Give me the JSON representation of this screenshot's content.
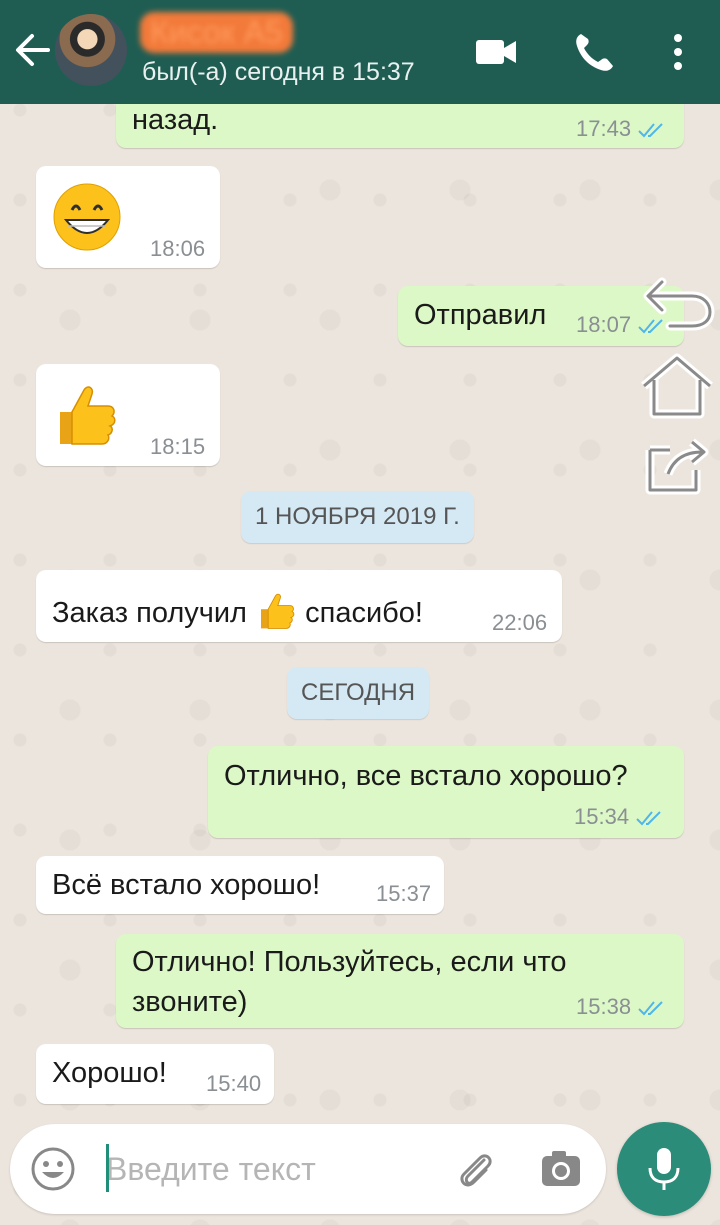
{
  "header": {
    "contact_name": "Кисок А5",
    "status": "был(-а) сегодня в 15:37"
  },
  "messages": [
    {
      "id": "m1",
      "dir": "out",
      "text": "назад.",
      "time": "17:43"
    },
    {
      "id": "m2",
      "dir": "in",
      "emoji": "grinning-face",
      "time": "18:06"
    },
    {
      "id": "m3",
      "dir": "out",
      "text": "Отправил",
      "time": "18:07"
    },
    {
      "id": "m4",
      "dir": "in",
      "emoji": "thumbs-up",
      "time": "18:15"
    },
    {
      "id": "m5",
      "dir": "in",
      "text_before": "Заказ получил",
      "emoji": "thumbs-up",
      "text_after": "спасибо!",
      "time": "22:06"
    },
    {
      "id": "m6",
      "dir": "out",
      "text": "Отлично, все встало хорошо?",
      "time": "15:34"
    },
    {
      "id": "m7",
      "dir": "in",
      "text": "Всё встало хорошо!",
      "time": "15:37"
    },
    {
      "id": "m8",
      "dir": "out",
      "text_line1": "Отлично! Пользуйтесь, если что",
      "text_line2": "звоните)",
      "time": "15:38"
    },
    {
      "id": "m9",
      "dir": "in",
      "text": "Хорошо!",
      "time": "15:40"
    }
  ],
  "date_chips": {
    "nov": "1 НОЯБРЯ 2019 Г.",
    "today": "СЕГОДНЯ"
  },
  "composer": {
    "placeholder": "Введите текст"
  },
  "colors": {
    "header": "#1f5d53",
    "outgoing": "#dcf8c6",
    "incoming": "#ffffff",
    "read_tick": "#4fb6ec",
    "mic": "#2b8c79"
  },
  "icons": [
    "back-arrow-icon",
    "video-call-icon",
    "phone-icon",
    "more-vert-icon",
    "double-check-icon",
    "reply-icon",
    "home-icon",
    "share-icon",
    "emoji-icon",
    "attach-icon",
    "camera-icon",
    "mic-icon"
  ]
}
